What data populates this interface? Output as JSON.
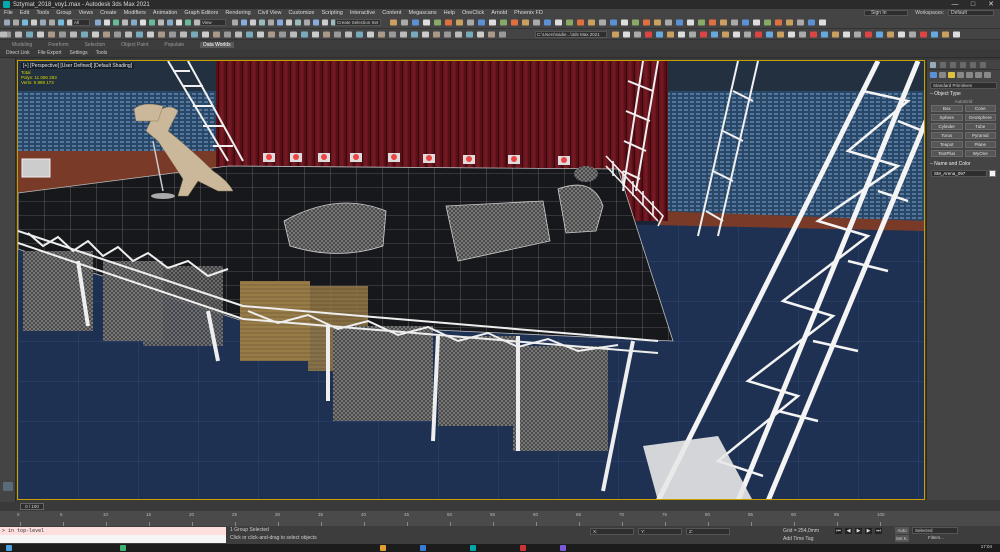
{
  "window": {
    "title": "Sztymat_2018_voy1.max - Autodesk 3ds Max 2021",
    "controls": [
      "—",
      "□",
      "✕"
    ]
  },
  "menu": {
    "items": [
      "File",
      "Edit",
      "Tools",
      "Group",
      "Views",
      "Create",
      "Modifiers",
      "Animation",
      "Graph Editors",
      "Rendering",
      "Civil View",
      "Customize",
      "Scripting",
      "Interactive",
      "Content",
      "Megascans",
      "Help",
      "OneClick",
      "Arnold",
      "Phoenix FD"
    ],
    "sign_in": "Sign In",
    "workspaces_label": "Workspaces:",
    "workspace_value": "Default"
  },
  "toolbar": {
    "selection_filter": "All",
    "view_dropdown": "View",
    "named_selection": "Create Selection Set",
    "path_field": "C:\\Users\\sadie...\\3ds Max 2021"
  },
  "ribbon": {
    "tabs": [
      "Modeling",
      "Freeform",
      "Selection",
      "Object Paint",
      "Populate",
      "Data Worlds"
    ],
    "active_tab": "Data Worlds"
  },
  "subtabs": [
    "Direct Link",
    "File Export",
    "Settings",
    "Tools"
  ],
  "viewport": {
    "label": "[+] [Perspective] [User Defined] [Default Shading]",
    "stats": [
      "Total",
      "Polys: 11 056 283",
      "Verts: 5 889 173"
    ]
  },
  "command_panel": {
    "category": "Standard Primitives",
    "object_type_title": "Object Type",
    "autogrid": "AutoGrid",
    "buttons": [
      "Box",
      "Cone",
      "Sphere",
      "GeoSphere",
      "Cylinder",
      "Tube",
      "Torus",
      "Pyramid",
      "Teapot",
      "Plane",
      "TextPlus",
      "WyOne"
    ],
    "name_color_title": "Name and Color",
    "object_name": "SM_Arena_097"
  },
  "timeline": {
    "frame_display": "0 / 100",
    "ticks": [
      "0",
      "5",
      "10",
      "15",
      "20",
      "25",
      "30",
      "35",
      "40",
      "45",
      "50",
      "55",
      "60",
      "65",
      "70",
      "75",
      "80",
      "85",
      "90",
      "95",
      "100"
    ]
  },
  "status": {
    "maxscript": "> in top-level",
    "selection_info": "1 Group Selected",
    "prompt": "Click or click-and-drag to select objects",
    "x_label": "X:",
    "y_label": "Y:",
    "z_label": "Z:",
    "grid": "Grid = 254,0mm",
    "add_time_tag": "Add Time Tag",
    "auto": "Auto",
    "set_key": "Set K.",
    "selected": "Selected",
    "filters": "Filters...",
    "clock": "17:04"
  },
  "colors": {
    "chrome": "#444444",
    "viewport_border": "#c8a000",
    "maxscript_bg": "#ffdede",
    "stage_floor": "#17181c",
    "truss": "#f0f0f0",
    "curtain": "#6e1520"
  }
}
